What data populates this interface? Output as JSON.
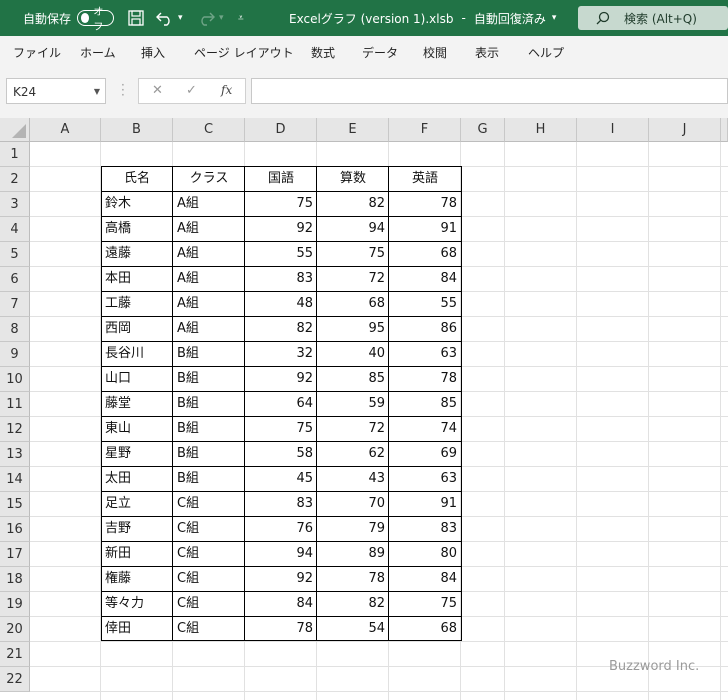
{
  "titlebar": {
    "autosave_label": "自動保存",
    "autosave_state": "オフ",
    "title": "Excelグラフ (version 1).xlsb",
    "save_status": "自動回復済み",
    "search_label": "検索 (Alt+Q)"
  },
  "ribbon_tabs": [
    "ファイル",
    "ホーム",
    "挿入",
    "ページ レイアウト",
    "数式",
    "データ",
    "校閲",
    "表示",
    "ヘルプ"
  ],
  "formula_bar": {
    "name_box": "K24",
    "fx": "fx",
    "formula": ""
  },
  "columns": [
    "A",
    "B",
    "C",
    "D",
    "E",
    "F",
    "G",
    "H",
    "I",
    "J"
  ],
  "rows": [
    "1",
    "2",
    "3",
    "4",
    "5",
    "6",
    "7",
    "8",
    "9",
    "10",
    "11",
    "12",
    "13",
    "14",
    "15",
    "16",
    "17",
    "18",
    "19",
    "20",
    "21",
    "22"
  ],
  "table": {
    "headers": [
      "氏名",
      "クラス",
      "国語",
      "算数",
      "英語"
    ],
    "rows": [
      [
        "鈴木",
        "A組",
        "75",
        "82",
        "78"
      ],
      [
        "高橋",
        "A組",
        "92",
        "94",
        "91"
      ],
      [
        "遠藤",
        "A組",
        "55",
        "75",
        "68"
      ],
      [
        "本田",
        "A組",
        "83",
        "72",
        "84"
      ],
      [
        "工藤",
        "A組",
        "48",
        "68",
        "55"
      ],
      [
        "西岡",
        "A組",
        "82",
        "95",
        "86"
      ],
      [
        "長谷川",
        "B組",
        "32",
        "40",
        "63"
      ],
      [
        "山口",
        "B組",
        "92",
        "85",
        "78"
      ],
      [
        "藤堂",
        "B組",
        "64",
        "59",
        "85"
      ],
      [
        "東山",
        "B組",
        "75",
        "72",
        "74"
      ],
      [
        "星野",
        "B組",
        "58",
        "62",
        "69"
      ],
      [
        "太田",
        "B組",
        "45",
        "43",
        "63"
      ],
      [
        "足立",
        "C組",
        "83",
        "70",
        "91"
      ],
      [
        "吉野",
        "C組",
        "76",
        "79",
        "83"
      ],
      [
        "新田",
        "C組",
        "94",
        "89",
        "80"
      ],
      [
        "権藤",
        "C組",
        "92",
        "78",
        "84"
      ],
      [
        "等々力",
        "C組",
        "84",
        "82",
        "75"
      ],
      [
        "倖田",
        "C組",
        "78",
        "54",
        "68"
      ]
    ]
  },
  "watermark": "Buzzword Inc.",
  "colors": {
    "title_bar": "#217346",
    "accent": "#217346"
  }
}
